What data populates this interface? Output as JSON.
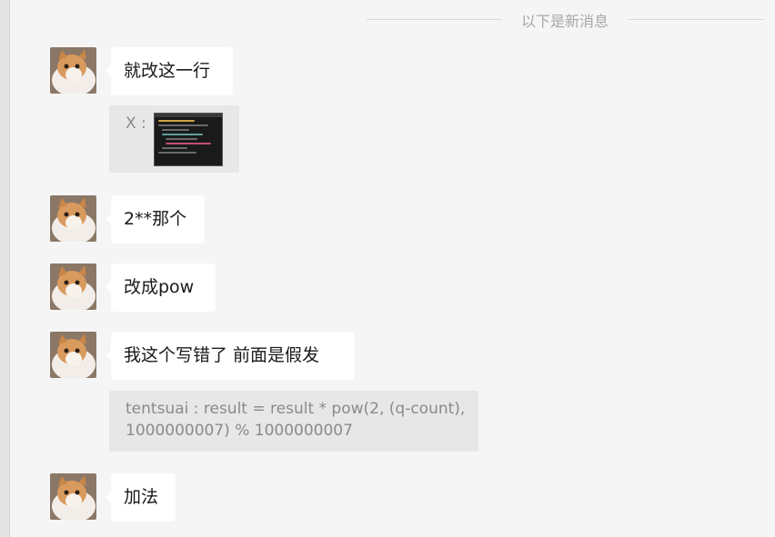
{
  "divider": {
    "label": "以下是新消息"
  },
  "messages": [
    {
      "text": "就改这一行"
    },
    {
      "text": "2**那个"
    },
    {
      "text": "改成pow"
    },
    {
      "text": "我这个写错了 前面是假发"
    },
    {
      "text": "加法"
    }
  ],
  "quotes": [
    {
      "sender": "X :",
      "kind": "image-thumbnail",
      "thumbnail_icon": "code-screenshot-icon"
    },
    {
      "text": "tentsuai : result = result * pow(2, (q-count),\n1000000007) % 1000000007"
    }
  ],
  "colors": {
    "background": "#f5f5f5",
    "bubble": "#ffffff",
    "quote_background": "#e7e7e7",
    "quote_text": "#8a8a8a",
    "divider_text": "#a8a8a8"
  },
  "icons": {
    "avatar": "cat-avatar-icon"
  }
}
